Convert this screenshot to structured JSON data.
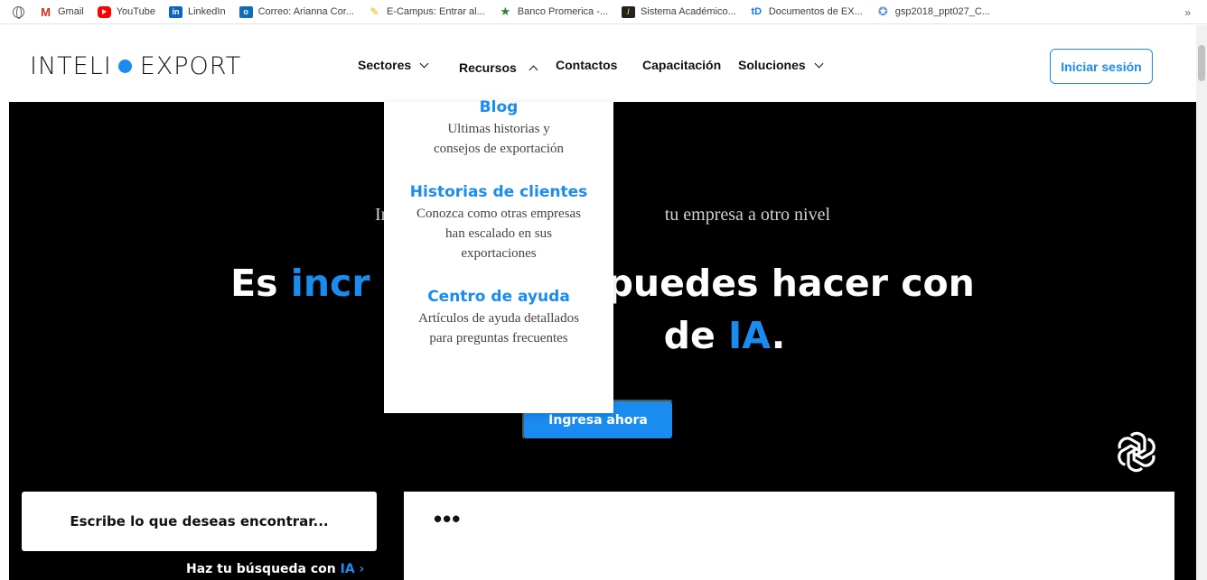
{
  "bookmarks": [
    {
      "label": "Gmail",
      "icon": "gmail-icon"
    },
    {
      "label": "YouTube",
      "icon": "youtube-icon"
    },
    {
      "label": "LinkedIn",
      "icon": "linkedin-icon"
    },
    {
      "label": "Correo: Arianna Cor...",
      "icon": "outlook-icon"
    },
    {
      "label": "E-Campus: Entrar al...",
      "icon": "ecampus-icon"
    },
    {
      "label": "Banco Promerica -...",
      "icon": "star-icon"
    },
    {
      "label": "Sistema Académico...",
      "icon": "sistema-icon"
    },
    {
      "label": "Documentos de EX...",
      "icon": "td-icon"
    },
    {
      "label": "gsp2018_ppt027_C...",
      "icon": "un-icon"
    }
  ],
  "bookmarks_more": "»",
  "logo": {
    "left": "INTELI",
    "right": "EXPORT",
    "accent": "#1a8cf0"
  },
  "nav": {
    "sectores": "Sectores",
    "recursos": "Recursos",
    "contactos": "Contactos",
    "capacitacion": "Capacitación",
    "soluciones": "Soluciones",
    "login": "Iniciar sesión"
  },
  "dropdown": {
    "blog": {
      "title": "Blog",
      "desc": "Ultimas historias y consejos de exportación"
    },
    "historias": {
      "title": "Historias de clientes",
      "desc": "Conozca como otras empresas han escalado en sus exportaciones"
    },
    "ayuda": {
      "title": "Centro de ayuda",
      "desc": "Artículos de ayuda detallados para preguntas frecuentes"
    }
  },
  "hero": {
    "sub_left": "Impul",
    "sub_right": "tu empresa a otro nivel",
    "title_l1_a": "Es ",
    "title_l1_b": "incr",
    "title_l1_c": "puedes hacer con",
    "title_l2_a": "de ",
    "title_l2_b": "IA",
    "title_l2_c": ".",
    "cta": "Ingresa ahora",
    "search_label": "Escribe lo que deseas encontrar...",
    "haz_a": "Haz tu búsqueda con ",
    "haz_b": "IA",
    "haz_c": " ›",
    "chat_dots": "•••"
  }
}
